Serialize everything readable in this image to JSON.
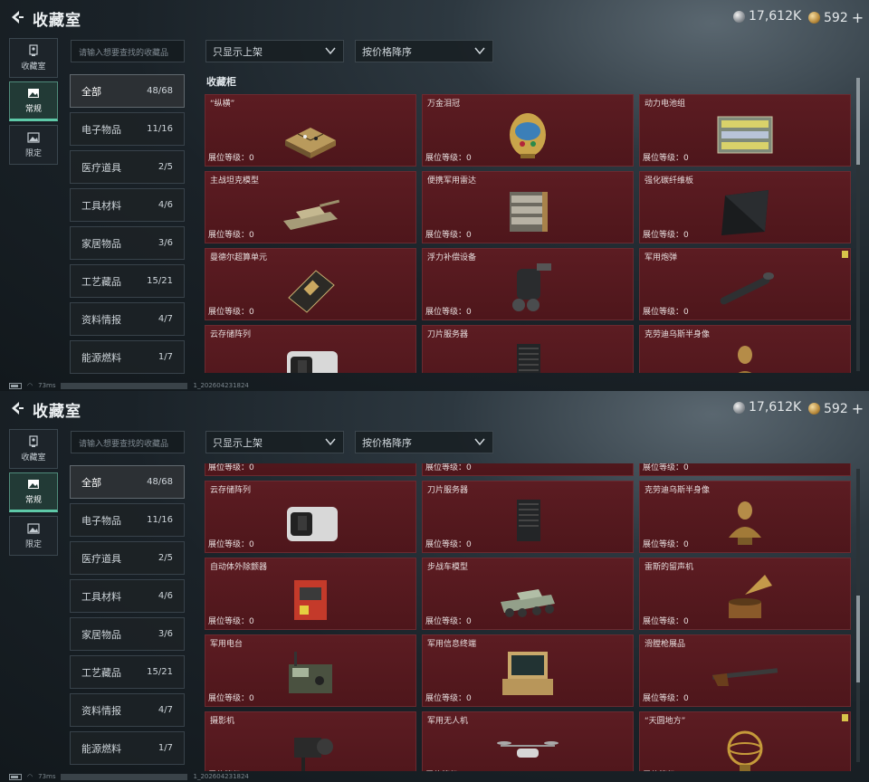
{
  "title": "收藏室",
  "currency": {
    "silver": "17,612K",
    "gold": "592",
    "add": "+"
  },
  "leftnav": [
    {
      "label": "收藏室",
      "icon": "trophy-icon"
    },
    {
      "label": "常规",
      "icon": "picture-icon",
      "active": true
    },
    {
      "label": "限定",
      "icon": "picture-icon"
    }
  ],
  "search": {
    "placeholder": "请输入想要查找的收藏品"
  },
  "filters": {
    "shelf": "只显示上架",
    "sort": "按价格降序"
  },
  "categories": [
    {
      "label": "全部",
      "count": "48/68",
      "active": true
    },
    {
      "label": "电子物品",
      "count": "11/16"
    },
    {
      "label": "医疗道具",
      "count": "2/5"
    },
    {
      "label": "工具材料",
      "count": "4/6"
    },
    {
      "label": "家居物品",
      "count": "3/6"
    },
    {
      "label": "工艺藏品",
      "count": "15/21"
    },
    {
      "label": "资料情报",
      "count": "4/7"
    },
    {
      "label": "能源燃料",
      "count": "1/7"
    }
  ],
  "section_title": "收藏柜",
  "level_label": "展位等级：0",
  "screen1_items": [
    {
      "name": "“纵横”",
      "icon": "chessboard-icon"
    },
    {
      "name": "万金泪冠",
      "icon": "jeweled-egg-icon"
    },
    {
      "name": "动力电池组",
      "icon": "battery-pack-icon"
    },
    {
      "name": "主战坦克模型",
      "icon": "tank-model-icon"
    },
    {
      "name": "便携军用雷达",
      "icon": "radar-icon"
    },
    {
      "name": "强化碳纤维板",
      "icon": "carbon-plate-icon"
    },
    {
      "name": "曼德尔超算单元",
      "icon": "compute-unit-icon"
    },
    {
      "name": "浮力补偿设备",
      "icon": "buoyancy-device-icon"
    },
    {
      "name": "军用炮弹",
      "icon": "shell-icon",
      "badge": true
    },
    {
      "name": "云存储阵列",
      "icon": "storage-array-icon"
    },
    {
      "name": "刀片服务器",
      "icon": "server-icon"
    },
    {
      "name": "克劳迪乌斯半身像",
      "icon": "bust-icon"
    }
  ],
  "screen2_items": [
    {
      "name": "云存储阵列",
      "icon": "storage-array-icon"
    },
    {
      "name": "刀片服务器",
      "icon": "server-icon"
    },
    {
      "name": "克劳迪乌斯半身像",
      "icon": "bust-icon"
    },
    {
      "name": "自动体外除颤器",
      "icon": "defibrillator-icon"
    },
    {
      "name": "步战车模型",
      "icon": "ifv-model-icon"
    },
    {
      "name": "雷斯的留声机",
      "icon": "gramophone-icon"
    },
    {
      "name": "军用电台",
      "icon": "radio-icon"
    },
    {
      "name": "军用信息终端",
      "icon": "terminal-icon"
    },
    {
      "name": "滑膛枪展品",
      "icon": "musket-icon"
    },
    {
      "name": "摄影机",
      "icon": "camera-icon"
    },
    {
      "name": "军用无人机",
      "icon": "drone-icon"
    },
    {
      "name": "“天圆地方”",
      "icon": "armillary-icon",
      "badge": true
    }
  ],
  "status": {
    "ping": "73ms",
    "build": "1_202604231824"
  },
  "colors": {
    "card": "#5a1a1f",
    "accent": "#5ec9a8"
  }
}
